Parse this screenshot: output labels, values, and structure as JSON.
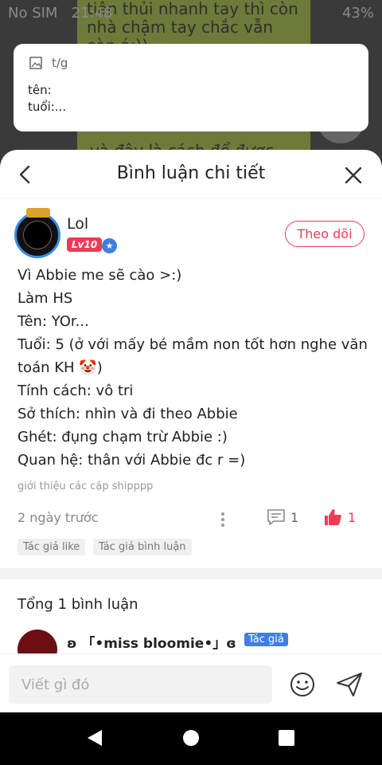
{
  "status_bar": {
    "carrier": "No SIM",
    "time": "21:48",
    "battery": "43%"
  },
  "background": {
    "bubble_top": "tiên thủi nhanh tay thì còn\nnhà chậm tay chắc vẫn\ncòn á:))",
    "bubble_bottom": "và đây là cách để được"
  },
  "preview": {
    "icon": "image-icon",
    "tag": "t/g",
    "lines": "tên:\ntuổi:..."
  },
  "sheet": {
    "title": "Bình luận chi tiết",
    "back_icon": "chevron-left-icon",
    "close_icon": "close-icon"
  },
  "author": {
    "name": "Lol",
    "level": "Lv10",
    "follow_label": "Theo dõi"
  },
  "post": {
    "lines": [
      "Vì Abbie me sẽ cào >:)",
      "Làm HS",
      "Tên: YOr...",
      "Tuổi: 5 (ở với mấy bé mầm non tốt hơn nghe văn toán KH 🤡)",
      "Tính cách: vô tri",
      "Sở thích: nhìn và đi theo Abbie",
      "Ghét: đụng chạm trừ Abbie :)",
      "Quan hệ: thân với Abbie đc r =)"
    ],
    "topic": "giới thiệu các cặp shipppp",
    "time": "2 ngày trước",
    "comment_count": "1",
    "like_count": "1",
    "chips": [
      "Tác giả like",
      "Tác giả bình luận"
    ]
  },
  "comments": {
    "total_label": "Tổng 1 bình luận",
    "first": {
      "name": "ʚ 「•miss bloomie•」ɞ",
      "badge": "Tác giả"
    }
  },
  "compose": {
    "placeholder": "Viết gì đó"
  },
  "colors": {
    "accent": "#ef3b55",
    "badge_blue": "#3d7fe0"
  }
}
